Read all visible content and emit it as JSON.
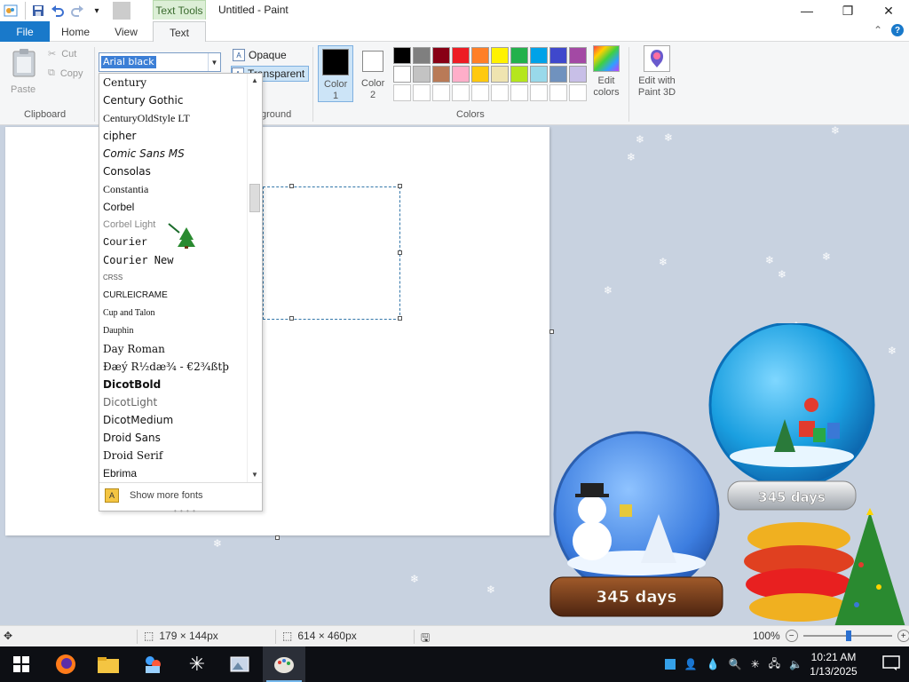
{
  "window": {
    "title": "Untitled - Paint",
    "context_tab_header": "Text Tools",
    "minimize": "—",
    "maximize": "❐",
    "close": "✕"
  },
  "ribbon_tabs": [
    "File",
    "Home",
    "View",
    "Text"
  ],
  "ribbon_help": {
    "collapse": "⌃",
    "help": "?"
  },
  "clipboard": {
    "paste": "Paste",
    "cut": "Cut",
    "copy": "Copy",
    "group_label": "Clipboard"
  },
  "font": {
    "current": "Arial black",
    "list": [
      "Century",
      "Century Gothic",
      "CenturyOldStyle LT",
      "cipher",
      "Comic Sans MS",
      "Consolas",
      "Constantia",
      "Corbel",
      "Corbel Light",
      "Courier",
      "Courier New",
      "CRSS",
      "CURLEICRAME",
      "Cup and Talon",
      "Dauphin",
      "Day Roman",
      "Ðæý R½dæ¾ - €2¾ßtþ",
      "DicotBold",
      "DicotLight",
      "DicotMedium",
      "Droid Sans",
      "Droid Serif",
      "Ebrima"
    ],
    "show_more": "Show more fonts"
  },
  "background": {
    "opaque": "Opaque",
    "transparent": "Transparent",
    "group_label_visible": "ground"
  },
  "colors": {
    "color1_label": "Color 1",
    "color2_label": "Color 2",
    "color1": "#000000",
    "color2": "#ffffff",
    "group_label": "Colors",
    "edit_colors": "Edit colors",
    "edit_paint3d": "Edit with Paint 3D",
    "palette_row1": [
      "#000000",
      "#7f7f7f",
      "#880015",
      "#ed1c24",
      "#ff7f27",
      "#fff200",
      "#22b14c",
      "#00a2e8",
      "#3f48cc",
      "#a349a4"
    ],
    "palette_row2": [
      "#ffffff",
      "#c3c3c3",
      "#b97a57",
      "#ffaec9",
      "#ffc90e",
      "#efe4b0",
      "#b5e61d",
      "#99d9ea",
      "#7092be",
      "#c8bfe7"
    ]
  },
  "status": {
    "selection_size": "179 × 144px",
    "canvas_size": "614 × 460px",
    "zoom": "100%"
  },
  "taskbar": {
    "time": "10:21 AM",
    "date": "1/13/2025"
  },
  "decor": {
    "globe_left_label": "345 days",
    "globe_right_label": "345 days"
  }
}
